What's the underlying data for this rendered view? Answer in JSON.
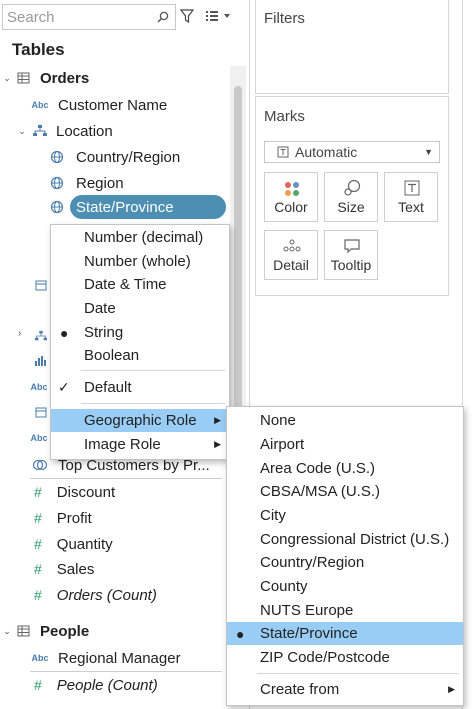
{
  "search": {
    "placeholder": "Search"
  },
  "data_pane": {
    "title": "Tables",
    "orders_table": "Orders",
    "fields": {
      "customer_name": "Customer Name",
      "location": "Location",
      "country_region": "Country/Region",
      "region": "Region",
      "state_province": "State/Province",
      "top_customers": "Top Customers by Pr...",
      "discount": "Discount",
      "profit": "Profit",
      "quantity": "Quantity",
      "sales": "Sales",
      "orders_count": "Orders (Count)"
    },
    "people_table": "People",
    "people_fields": {
      "regional_manager": "Regional Manager",
      "people_count": "People (Count)"
    },
    "type_icon_abc": "Abc"
  },
  "filters": {
    "title": "Filters"
  },
  "marks": {
    "title": "Marks",
    "type_value": "Automatic",
    "buttons": {
      "color": "Color",
      "size": "Size",
      "text": "Text",
      "detail": "Detail",
      "tooltip": "Tooltip"
    }
  },
  "context_menu": {
    "items": {
      "number_decimal": "Number (decimal)",
      "number_whole": "Number (whole)",
      "date_time": "Date & Time",
      "date": "Date",
      "string": "String",
      "boolean": "Boolean",
      "default": "Default",
      "geographic_role": "Geographic Role",
      "image_role": "Image Role"
    }
  },
  "geo_submenu": {
    "items": {
      "none": "None",
      "airport": "Airport",
      "area_code": "Area Code (U.S.)",
      "cbsa": "CBSA/MSA (U.S.)",
      "city": "City",
      "congressional": "Congressional District (U.S.)",
      "country_region": "Country/Region",
      "county": "County",
      "nuts": "NUTS Europe",
      "state_province": "State/Province",
      "zip": "ZIP Code/Postcode",
      "create_from": "Create from"
    },
    "selected": "State/Province"
  },
  "colors": {
    "pill": "#4c8fb2",
    "menu_highlight": "#99cdf5",
    "measure_green": "#2d9a6a",
    "dimension_blue": "#4b7dae"
  }
}
